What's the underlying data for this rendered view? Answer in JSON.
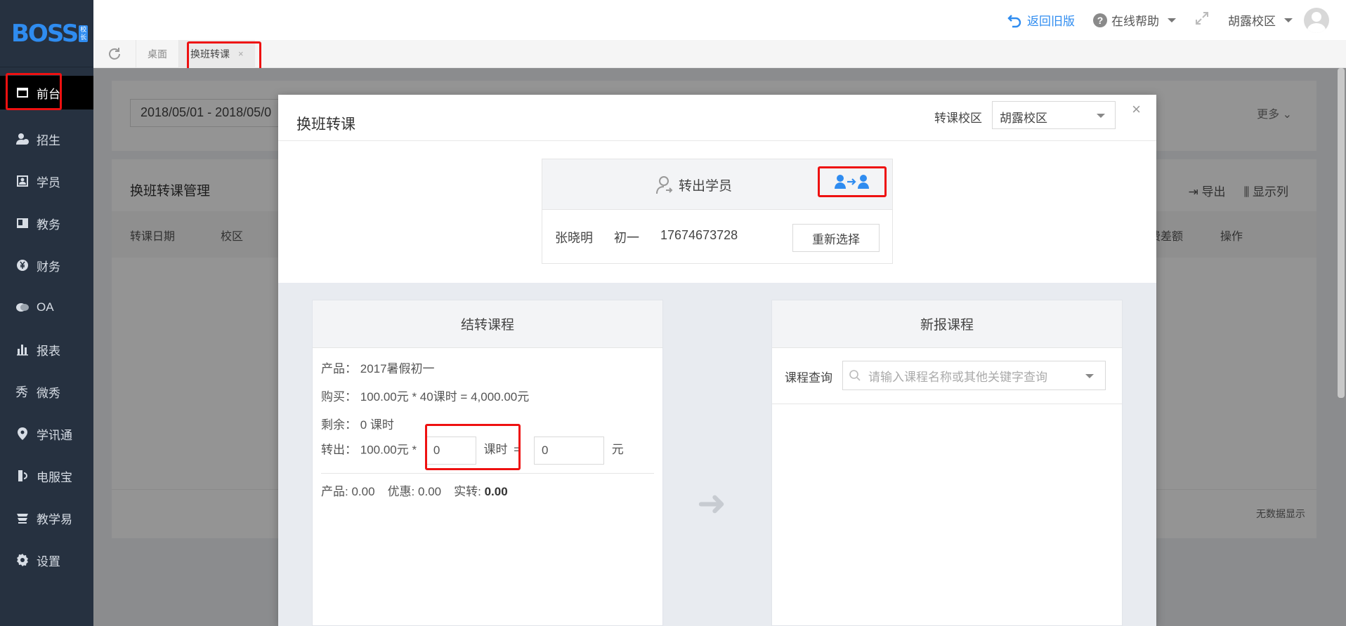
{
  "brand": {
    "logo": "BOSS",
    "badge": [
      "校",
      "长"
    ]
  },
  "sidebar": {
    "items": [
      {
        "label": "前台",
        "icon": "calendar-window-icon"
      },
      {
        "label": "招生",
        "icon": "user-add-icon"
      },
      {
        "label": "学员",
        "icon": "id-card-icon"
      },
      {
        "label": "教务",
        "icon": "book-icon"
      },
      {
        "label": "财务",
        "icon": "yen-icon"
      },
      {
        "label": "OA",
        "icon": "chat-icon"
      },
      {
        "label": "报表",
        "icon": "bar-chart-icon"
      },
      {
        "label": "微秀",
        "icon": "xiu-icon"
      },
      {
        "label": "学讯通",
        "icon": "location-icon"
      },
      {
        "label": "电服宝",
        "icon": "phone-service-icon"
      },
      {
        "label": "教学易",
        "icon": "teaching-icon"
      },
      {
        "label": "设置",
        "icon": "gear-icon"
      }
    ]
  },
  "topbar": {
    "back_old": "返回旧版",
    "help": "在线帮助",
    "campus": "胡露校区"
  },
  "tabs": [
    {
      "label": "桌面"
    },
    {
      "label": "换班转课",
      "close": "×"
    }
  ],
  "background": {
    "date_range": "2018/05/01 - 2018/05/0",
    "more": "更多",
    "title": "换班转课管理",
    "cols": [
      "转课日期",
      "校区",
      "费差额",
      "操作"
    ],
    "export": "导出",
    "show_cols": "显示列",
    "nodata": "无数据显示"
  },
  "modal": {
    "title": "换班转课",
    "campus_label": "转课校区",
    "campus_value": "胡露校区",
    "close": "×",
    "student": {
      "title": "转出学员",
      "name": "张晓明",
      "grade": "初一",
      "phone": "17674673728",
      "reselect": "重新选择"
    },
    "left_panel": {
      "title": "结转课程",
      "product_label": "产品：",
      "product_value": "2017暑假初一",
      "buy_label": "购买：",
      "buy_value": "100.00元 * 40课时 = 4,000.00元",
      "remain_label": "剩余：",
      "remain_value": "0 课时",
      "out_label": "转出：",
      "out_price": "100.00元 *",
      "out_hours": "0",
      "hours_unit": "课时",
      "eq": "=",
      "out_amount": "0",
      "yuan": "元",
      "summary_product_label": "产品:",
      "summary_product": "0.00",
      "summary_discount_label": "优惠:",
      "summary_discount": "0.00",
      "summary_actual_label": "实转:",
      "summary_actual": "0.00"
    },
    "right_panel": {
      "title": "新报课程",
      "search_label": "课程查询",
      "search_placeholder": "请输入课程名称或其他关键字查询"
    }
  }
}
